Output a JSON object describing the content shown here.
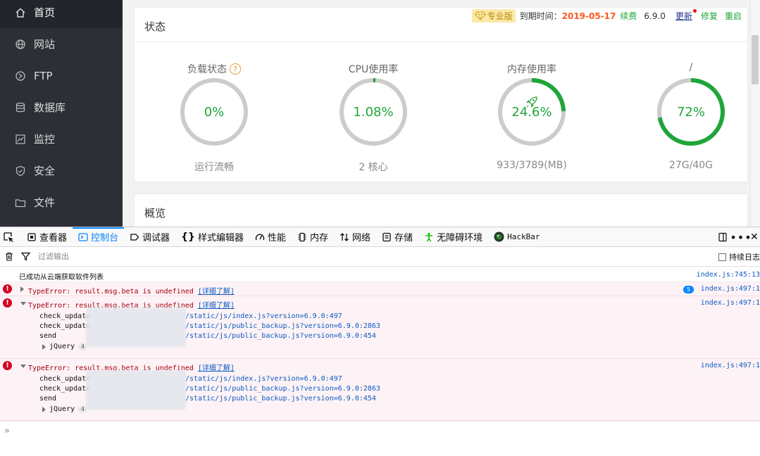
{
  "sidebar": {
    "items": [
      {
        "label": "首页",
        "icon": "home-icon"
      },
      {
        "label": "网站",
        "icon": "globe-icon"
      },
      {
        "label": "FTP",
        "icon": "ftp-icon"
      },
      {
        "label": "数据库",
        "icon": "database-icon"
      },
      {
        "label": "监控",
        "icon": "monitor-icon"
      },
      {
        "label": "安全",
        "icon": "shield-icon"
      },
      {
        "label": "文件",
        "icon": "folder-icon"
      }
    ]
  },
  "topbar": {
    "pro_label": "专业版",
    "expire_label": "到期时间：",
    "expire_date": "2019-05-17",
    "renew": "续费",
    "version": "6.9.0",
    "update": "更新",
    "repair": "修复",
    "restart": "重启"
  },
  "status": {
    "title": "状态",
    "gauges": [
      {
        "title": "负载状态",
        "value": "0%",
        "sub": "运行流畅",
        "percent": 0,
        "help": "?"
      },
      {
        "title": "CPU使用率",
        "value": "1.08%",
        "sub": "2 核心",
        "percent": 1.08
      },
      {
        "title": "内存使用率",
        "value": "24.6%",
        "sub": "933/3789(MB)",
        "percent": 24.6
      },
      {
        "title": "/",
        "value": "72%",
        "sub": "27G/40G",
        "percent": 72
      }
    ]
  },
  "overview": {
    "title": "概览"
  },
  "colors": {
    "green": "#20a53a",
    "ring_bg": "#cccccc",
    "sidebar": "#2c2f36",
    "accent_blue": "#0a84ff",
    "error_red": "#d70022"
  },
  "devtools": {
    "tabs": [
      {
        "label": "查看器",
        "icon": "inspector-icon"
      },
      {
        "label": "控制台",
        "icon": "console-icon"
      },
      {
        "label": "调试器",
        "icon": "debugger-icon"
      },
      {
        "label": "样式编辑器",
        "icon": "style-editor-icon"
      },
      {
        "label": "性能",
        "icon": "performance-icon"
      },
      {
        "label": "内存",
        "icon": "memory-icon"
      },
      {
        "label": "网络",
        "icon": "network-icon"
      },
      {
        "label": "存储",
        "icon": "storage-icon"
      },
      {
        "label": "无障碍环境",
        "icon": "accessibility-icon"
      },
      {
        "label": "HackBar",
        "icon": "hackbar-icon"
      }
    ],
    "filter_placeholder": "过滤输出",
    "persist_label": "持续日志"
  },
  "console": {
    "log": {
      "text": "已成功从云端获取软件列表",
      "loc": "index.js:745:13"
    },
    "errors": [
      {
        "text": "TypeError: result.msg.beta is undefined",
        "learn": "[详细了解]",
        "loc": "index.js:497:1",
        "repeat": "5"
      },
      {
        "text": "TypeError: result.msg.beta is undefined",
        "learn": "[详细了解]",
        "loc": "index.js:497:1",
        "frames": [
          {
            "fn": "check_update",
            "src": "/static/js/index.js?version=6.9.0:497"
          },
          {
            "fn": "check_update",
            "src": "/static/js/public_backup.js?version=6.9.0:2863"
          },
          {
            "fn": "send",
            "src": "/static/js/public_backup.js?version=6.9.0:454"
          }
        ],
        "jquery": "jQuery",
        "jquery_count": "4"
      },
      {
        "text": "TypeError: result.msg.beta is undefined",
        "learn": "[详细了解]",
        "loc": "index.js:497:1",
        "frames": [
          {
            "fn": "check_update",
            "src": "/static/js/index.js?version=6.9.0:497"
          },
          {
            "fn": "check_update",
            "src": "/static/js/public_backup.js?version=6.9.0:2863"
          },
          {
            "fn": "send",
            "src": "/static/js/public_backup.js?version=6.9.0:454"
          }
        ],
        "jquery": "jQuery",
        "jquery_count": "4"
      }
    ],
    "prompt": "»"
  }
}
